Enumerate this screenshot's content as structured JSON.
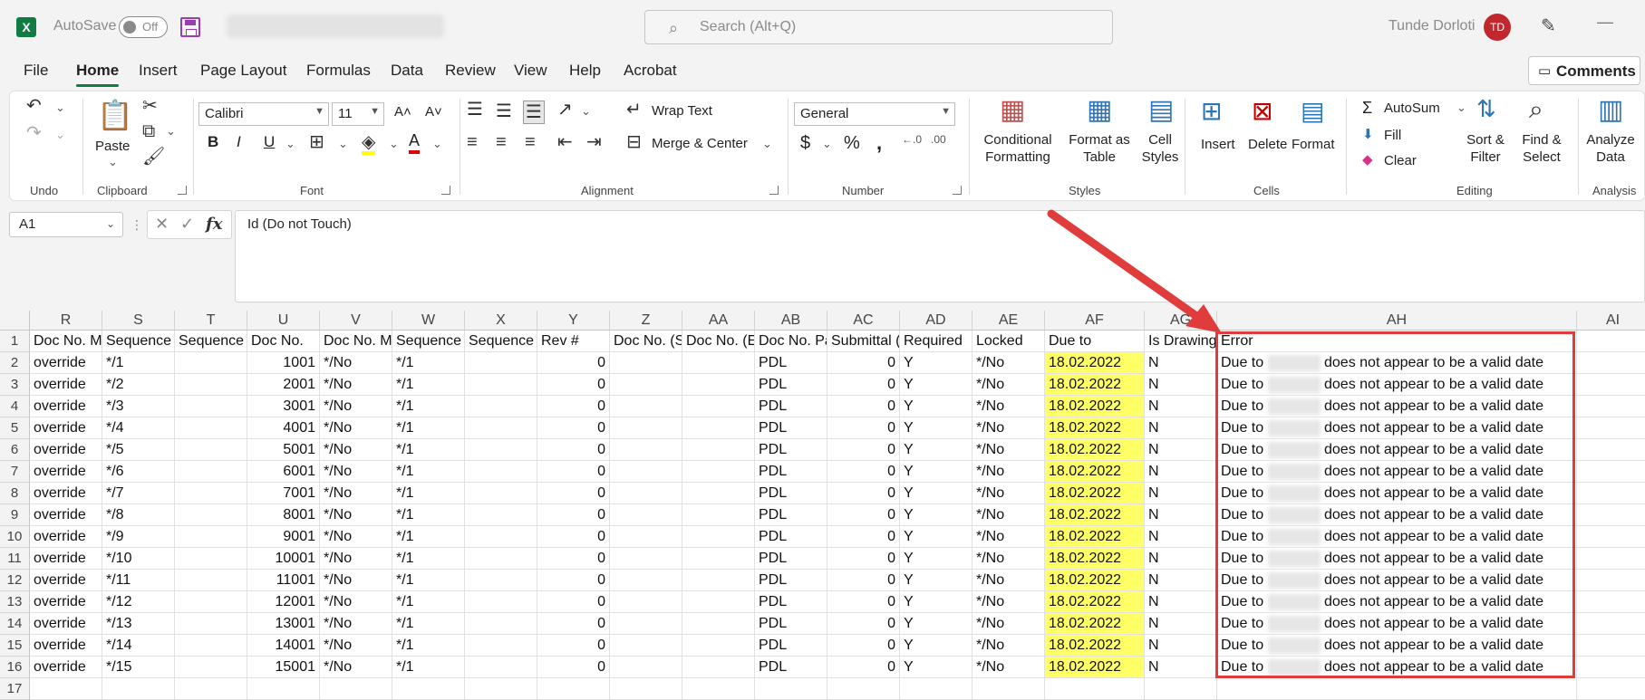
{
  "titlebar": {
    "autosave_label": "AutoSave",
    "autosave_state": "Off",
    "search_placeholder": "Search (Alt+Q)",
    "user_name": "Tunde Dorloti",
    "user_initials": "TD"
  },
  "menu": {
    "tabs": [
      "File",
      "Home",
      "Insert",
      "Page Layout",
      "Formulas",
      "Data",
      "Review",
      "View",
      "Help",
      "Acrobat"
    ],
    "active": "Home",
    "comments": "Comments"
  },
  "ribbon": {
    "undo_group": "Undo",
    "clipboard_group": "Clipboard",
    "paste": "Paste",
    "font_group": "Font",
    "font_name": "Calibri",
    "font_size": "11",
    "alignment_group": "Alignment",
    "wrap_text": "Wrap Text",
    "merge_center": "Merge & Center",
    "number_group": "Number",
    "number_format": "General",
    "styles_group": "Styles",
    "conditional_formatting": [
      "Conditional",
      "Formatting"
    ],
    "format_as_table": [
      "Format as",
      "Table"
    ],
    "cell_styles": [
      "Cell",
      "Styles"
    ],
    "cells_group": "Cells",
    "insert": "Insert",
    "delete": "Delete",
    "format": "Format",
    "editing_group": "Editing",
    "autosum": "AutoSum",
    "fill": "Fill",
    "clear": "Clear",
    "sort_filter": [
      "Sort &",
      "Filter"
    ],
    "find_select": [
      "Find &",
      "Select"
    ],
    "analysis_group": "Analysis",
    "analyze_data": [
      "Analyze",
      "Data"
    ]
  },
  "formula_bar": {
    "name_box": "A1",
    "content": "Id (Do not Touch)"
  },
  "grid": {
    "columns": [
      "R",
      "S",
      "T",
      "U",
      "V",
      "W",
      "X",
      "Y",
      "Z",
      "AA",
      "AB",
      "AC",
      "AD",
      "AE",
      "AF",
      "AG",
      "AH",
      "AI"
    ],
    "header_row": [
      "Doc No. M",
      "Sequence",
      "Sequence (",
      "Doc No.",
      "Doc No. M",
      "Sequence",
      "Sequence (",
      "Rev #",
      "Doc No. (S",
      "Doc No. (E",
      "Doc No. Pa",
      "Submittal (",
      "Required",
      "Locked",
      "Due to",
      "Is Drawing",
      "Error",
      ""
    ],
    "rows": [
      [
        "override",
        "*/1",
        "",
        "1001",
        "*/No",
        "*/1",
        "",
        "0",
        "",
        "",
        "PDL",
        "0",
        "Y",
        "*/No",
        "18.02.2022",
        "N",
        "Due to",
        "does not appear to be a valid date"
      ],
      [
        "override",
        "*/2",
        "",
        "2001",
        "*/No",
        "*/1",
        "",
        "0",
        "",
        "",
        "PDL",
        "0",
        "Y",
        "*/No",
        "18.02.2022",
        "N",
        "Due to",
        "does not appear to be a valid date"
      ],
      [
        "override",
        "*/3",
        "",
        "3001",
        "*/No",
        "*/1",
        "",
        "0",
        "",
        "",
        "PDL",
        "0",
        "Y",
        "*/No",
        "18.02.2022",
        "N",
        "Due to",
        "does not appear to be a valid date"
      ],
      [
        "override",
        "*/4",
        "",
        "4001",
        "*/No",
        "*/1",
        "",
        "0",
        "",
        "",
        "PDL",
        "0",
        "Y",
        "*/No",
        "18.02.2022",
        "N",
        "Due to",
        "does not appear to be a valid date"
      ],
      [
        "override",
        "*/5",
        "",
        "5001",
        "*/No",
        "*/1",
        "",
        "0",
        "",
        "",
        "PDL",
        "0",
        "Y",
        "*/No",
        "18.02.2022",
        "N",
        "Due to",
        "does not appear to be a valid date"
      ],
      [
        "override",
        "*/6",
        "",
        "6001",
        "*/No",
        "*/1",
        "",
        "0",
        "",
        "",
        "PDL",
        "0",
        "Y",
        "*/No",
        "18.02.2022",
        "N",
        "Due to",
        "does not appear to be a valid date"
      ],
      [
        "override",
        "*/7",
        "",
        "7001",
        "*/No",
        "*/1",
        "",
        "0",
        "",
        "",
        "PDL",
        "0",
        "Y",
        "*/No",
        "18.02.2022",
        "N",
        "Due to",
        "does not appear to be a valid date"
      ],
      [
        "override",
        "*/8",
        "",
        "8001",
        "*/No",
        "*/1",
        "",
        "0",
        "",
        "",
        "PDL",
        "0",
        "Y",
        "*/No",
        "18.02.2022",
        "N",
        "Due to",
        "does not appear to be a valid date"
      ],
      [
        "override",
        "*/9",
        "",
        "9001",
        "*/No",
        "*/1",
        "",
        "0",
        "",
        "",
        "PDL",
        "0",
        "Y",
        "*/No",
        "18.02.2022",
        "N",
        "Due to",
        "does not appear to be a valid date"
      ],
      [
        "override",
        "*/10",
        "",
        "10001",
        "*/No",
        "*/1",
        "",
        "0",
        "",
        "",
        "PDL",
        "0",
        "Y",
        "*/No",
        "18.02.2022",
        "N",
        "Due to",
        "does not appear to be a valid date"
      ],
      [
        "override",
        "*/11",
        "",
        "11001",
        "*/No",
        "*/1",
        "",
        "0",
        "",
        "",
        "PDL",
        "0",
        "Y",
        "*/No",
        "18.02.2022",
        "N",
        "Due to",
        "does not appear to be a valid date"
      ],
      [
        "override",
        "*/12",
        "",
        "12001",
        "*/No",
        "*/1",
        "",
        "0",
        "",
        "",
        "PDL",
        "0",
        "Y",
        "*/No",
        "18.02.2022",
        "N",
        "Due to",
        "does not appear to be a valid date"
      ],
      [
        "override",
        "*/13",
        "",
        "13001",
        "*/No",
        "*/1",
        "",
        "0",
        "",
        "",
        "PDL",
        "0",
        "Y",
        "*/No",
        "18.02.2022",
        "N",
        "Due to",
        "does not appear to be a valid date"
      ],
      [
        "override",
        "*/14",
        "",
        "14001",
        "*/No",
        "*/1",
        "",
        "0",
        "",
        "",
        "PDL",
        "0",
        "Y",
        "*/No",
        "18.02.2022",
        "N",
        "Due to",
        "does not appear to be a valid date"
      ],
      [
        "override",
        "*/15",
        "",
        "15001",
        "*/No",
        "*/1",
        "",
        "0",
        "",
        "",
        "PDL",
        "0",
        "Y",
        "*/No",
        "18.02.2022",
        "N",
        "Due to",
        "does not appear to be a valid date"
      ]
    ],
    "row_numbers": [
      "1",
      "2",
      "3",
      "4",
      "5",
      "6",
      "7",
      "8",
      "9",
      "10",
      "11",
      "12",
      "13",
      "14",
      "15",
      "16",
      "17"
    ]
  },
  "colors": {
    "accent": "#107c41",
    "highlight_fill": "#ffff66",
    "annotation_red": "#e03c3c"
  }
}
